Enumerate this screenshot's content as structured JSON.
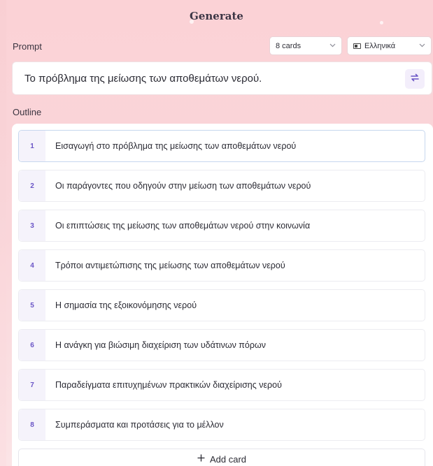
{
  "header": {
    "title": "Generate"
  },
  "prompt": {
    "label": "Prompt",
    "text": "Το πρόβλημα της μείωσης των αποθεμάτων νερού.",
    "cards_option": "8 cards",
    "language_option": "Ελληνικά"
  },
  "outline": {
    "label": "Outline",
    "cards": [
      {
        "number": "1",
        "text": "Εισαγωγή στο πρόβλημα της μείωσης των αποθεμάτων νερού"
      },
      {
        "number": "2",
        "text": "Οι παράγοντες που οδηγούν στην μείωση των αποθεμάτων νερού"
      },
      {
        "number": "3",
        "text": "Οι επιπτώσεις της μείωσης των αποθεμάτων νερού στην κοινωνία"
      },
      {
        "number": "4",
        "text": "Τρόποι αντιμετώπισης της μείωσης των αποθεμάτων νερού"
      },
      {
        "number": "5",
        "text": "Η σημασία της εξοικονόμησης νερού"
      },
      {
        "number": "6",
        "text": "Η ανάγκη για βιώσιμη διαχείριση των υδάτινων πόρων"
      },
      {
        "number": "7",
        "text": "Παραδείγματα επιτυχημένων πρακτικών διαχείρισης νερού"
      },
      {
        "number": "8",
        "text": "Συμπεράσματα και προτάσεις για το μέλλον"
      }
    ],
    "add_card_label": "Add card"
  },
  "icons": {
    "regenerate": "regenerate-icon",
    "chevron": "chevron-down-icon",
    "flag": "flag-icon",
    "plus": "plus-icon"
  },
  "colors": {
    "accent": "#6a55c6",
    "background": "#f9d2d6"
  }
}
